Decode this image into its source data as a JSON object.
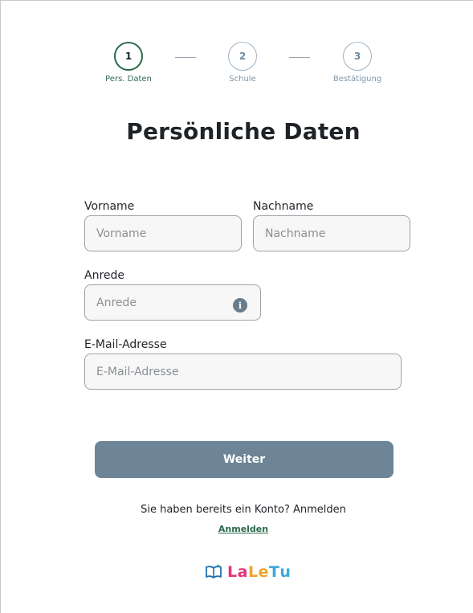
{
  "stepper": {
    "steps": [
      {
        "number": "1",
        "label": "Pers. Daten",
        "state": "active"
      },
      {
        "number": "2",
        "label": "Schule",
        "state": "inactive"
      },
      {
        "number": "3",
        "label": "Bestätigung",
        "state": "inactive"
      }
    ]
  },
  "page_title": "Persönliche Daten",
  "form": {
    "firstname": {
      "label": "Vorname",
      "placeholder": "Vorname",
      "value": ""
    },
    "lastname": {
      "label": "Nachname",
      "placeholder": "Nachname",
      "value": ""
    },
    "salutation": {
      "label": "Anrede",
      "placeholder": "Anrede",
      "value": "",
      "info_icon": "info-icon"
    },
    "email": {
      "label": "E-Mail-Adresse",
      "placeholder": "E-Mail-Adresse",
      "value": ""
    }
  },
  "submit_label": "Weiter",
  "account_prompt": "Sie haben bereits ein Konto? Anmelden",
  "login_link": "Anmelden",
  "logo": {
    "letters": [
      "L",
      "a",
      "L",
      "e",
      "T",
      "u"
    ],
    "colors": [
      "#e4347a",
      "#e4347a",
      "#f0a32a",
      "#f0a32a",
      "#3aa9dc",
      "#3aa9dc"
    ],
    "icon": "book-icon"
  },
  "colors": {
    "accent_green": "#2b6b4c",
    "button": "#6d8597",
    "inactive_step": "#9eb4c5"
  }
}
